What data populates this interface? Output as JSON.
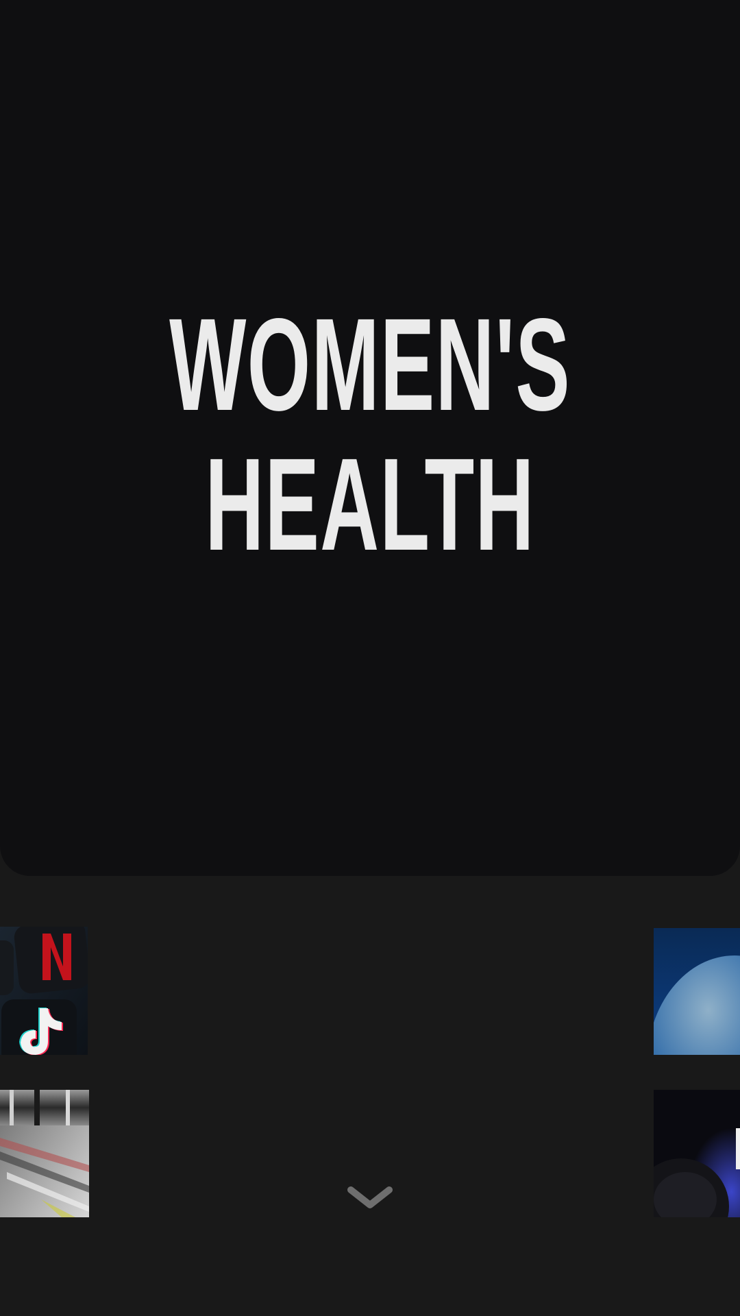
{
  "hero": {
    "title_line_1": "WOMEN'S",
    "title_line_2": "HEALTH"
  },
  "thumbnails": [
    {
      "name": "streaming-apps-thumbnail",
      "icons": [
        "netflix-icon",
        "tiktok-icon"
      ]
    },
    {
      "name": "blue-sphere-thumbnail"
    },
    {
      "name": "printing-press-thumbnail"
    },
    {
      "name": "microphone-thumbnail"
    }
  ],
  "scroll_indicator": {
    "icon": "chevron-down-icon"
  },
  "colors": {
    "page_background": "#191919",
    "hero_background": "#0f0f11",
    "title_text": "#ebebeb",
    "chevron": "#6e6e6e"
  }
}
